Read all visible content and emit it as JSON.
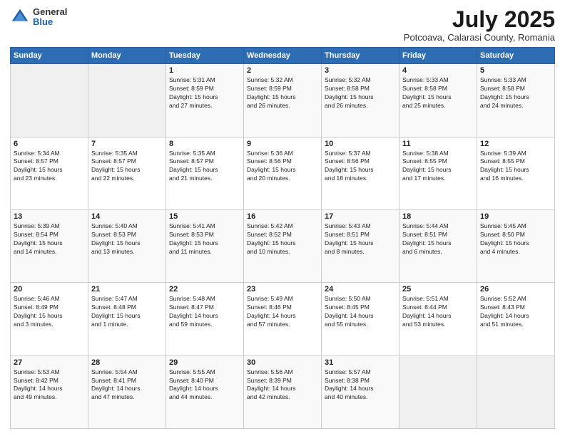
{
  "logo": {
    "general": "General",
    "blue": "Blue"
  },
  "title": "July 2025",
  "subtitle": "Potcoava, Calarasi County, Romania",
  "headers": [
    "Sunday",
    "Monday",
    "Tuesday",
    "Wednesday",
    "Thursday",
    "Friday",
    "Saturday"
  ],
  "weeks": [
    [
      {
        "num": "",
        "info": ""
      },
      {
        "num": "",
        "info": ""
      },
      {
        "num": "1",
        "info": "Sunrise: 5:31 AM\nSunset: 8:59 PM\nDaylight: 15 hours\nand 27 minutes."
      },
      {
        "num": "2",
        "info": "Sunrise: 5:32 AM\nSunset: 8:59 PM\nDaylight: 15 hours\nand 26 minutes."
      },
      {
        "num": "3",
        "info": "Sunrise: 5:32 AM\nSunset: 8:58 PM\nDaylight: 15 hours\nand 26 minutes."
      },
      {
        "num": "4",
        "info": "Sunrise: 5:33 AM\nSunset: 8:58 PM\nDaylight: 15 hours\nand 25 minutes."
      },
      {
        "num": "5",
        "info": "Sunrise: 5:33 AM\nSunset: 8:58 PM\nDaylight: 15 hours\nand 24 minutes."
      }
    ],
    [
      {
        "num": "6",
        "info": "Sunrise: 5:34 AM\nSunset: 8:57 PM\nDaylight: 15 hours\nand 23 minutes."
      },
      {
        "num": "7",
        "info": "Sunrise: 5:35 AM\nSunset: 8:57 PM\nDaylight: 15 hours\nand 22 minutes."
      },
      {
        "num": "8",
        "info": "Sunrise: 5:35 AM\nSunset: 8:57 PM\nDaylight: 15 hours\nand 21 minutes."
      },
      {
        "num": "9",
        "info": "Sunrise: 5:36 AM\nSunset: 8:56 PM\nDaylight: 15 hours\nand 20 minutes."
      },
      {
        "num": "10",
        "info": "Sunrise: 5:37 AM\nSunset: 8:56 PM\nDaylight: 15 hours\nand 18 minutes."
      },
      {
        "num": "11",
        "info": "Sunrise: 5:38 AM\nSunset: 8:55 PM\nDaylight: 15 hours\nand 17 minutes."
      },
      {
        "num": "12",
        "info": "Sunrise: 5:39 AM\nSunset: 8:55 PM\nDaylight: 15 hours\nand 16 minutes."
      }
    ],
    [
      {
        "num": "13",
        "info": "Sunrise: 5:39 AM\nSunset: 8:54 PM\nDaylight: 15 hours\nand 14 minutes."
      },
      {
        "num": "14",
        "info": "Sunrise: 5:40 AM\nSunset: 8:53 PM\nDaylight: 15 hours\nand 13 minutes."
      },
      {
        "num": "15",
        "info": "Sunrise: 5:41 AM\nSunset: 8:53 PM\nDaylight: 15 hours\nand 11 minutes."
      },
      {
        "num": "16",
        "info": "Sunrise: 5:42 AM\nSunset: 8:52 PM\nDaylight: 15 hours\nand 10 minutes."
      },
      {
        "num": "17",
        "info": "Sunrise: 5:43 AM\nSunset: 8:51 PM\nDaylight: 15 hours\nand 8 minutes."
      },
      {
        "num": "18",
        "info": "Sunrise: 5:44 AM\nSunset: 8:51 PM\nDaylight: 15 hours\nand 6 minutes."
      },
      {
        "num": "19",
        "info": "Sunrise: 5:45 AM\nSunset: 8:50 PM\nDaylight: 15 hours\nand 4 minutes."
      }
    ],
    [
      {
        "num": "20",
        "info": "Sunrise: 5:46 AM\nSunset: 8:49 PM\nDaylight: 15 hours\nand 3 minutes."
      },
      {
        "num": "21",
        "info": "Sunrise: 5:47 AM\nSunset: 8:48 PM\nDaylight: 15 hours\nand 1 minute."
      },
      {
        "num": "22",
        "info": "Sunrise: 5:48 AM\nSunset: 8:47 PM\nDaylight: 14 hours\nand 59 minutes."
      },
      {
        "num": "23",
        "info": "Sunrise: 5:49 AM\nSunset: 8:46 PM\nDaylight: 14 hours\nand 57 minutes."
      },
      {
        "num": "24",
        "info": "Sunrise: 5:50 AM\nSunset: 8:45 PM\nDaylight: 14 hours\nand 55 minutes."
      },
      {
        "num": "25",
        "info": "Sunrise: 5:51 AM\nSunset: 8:44 PM\nDaylight: 14 hours\nand 53 minutes."
      },
      {
        "num": "26",
        "info": "Sunrise: 5:52 AM\nSunset: 8:43 PM\nDaylight: 14 hours\nand 51 minutes."
      }
    ],
    [
      {
        "num": "27",
        "info": "Sunrise: 5:53 AM\nSunset: 8:42 PM\nDaylight: 14 hours\nand 49 minutes."
      },
      {
        "num": "28",
        "info": "Sunrise: 5:54 AM\nSunset: 8:41 PM\nDaylight: 14 hours\nand 47 minutes."
      },
      {
        "num": "29",
        "info": "Sunrise: 5:55 AM\nSunset: 8:40 PM\nDaylight: 14 hours\nand 44 minutes."
      },
      {
        "num": "30",
        "info": "Sunrise: 5:56 AM\nSunset: 8:39 PM\nDaylight: 14 hours\nand 42 minutes."
      },
      {
        "num": "31",
        "info": "Sunrise: 5:57 AM\nSunset: 8:38 PM\nDaylight: 14 hours\nand 40 minutes."
      },
      {
        "num": "",
        "info": ""
      },
      {
        "num": "",
        "info": ""
      }
    ]
  ]
}
